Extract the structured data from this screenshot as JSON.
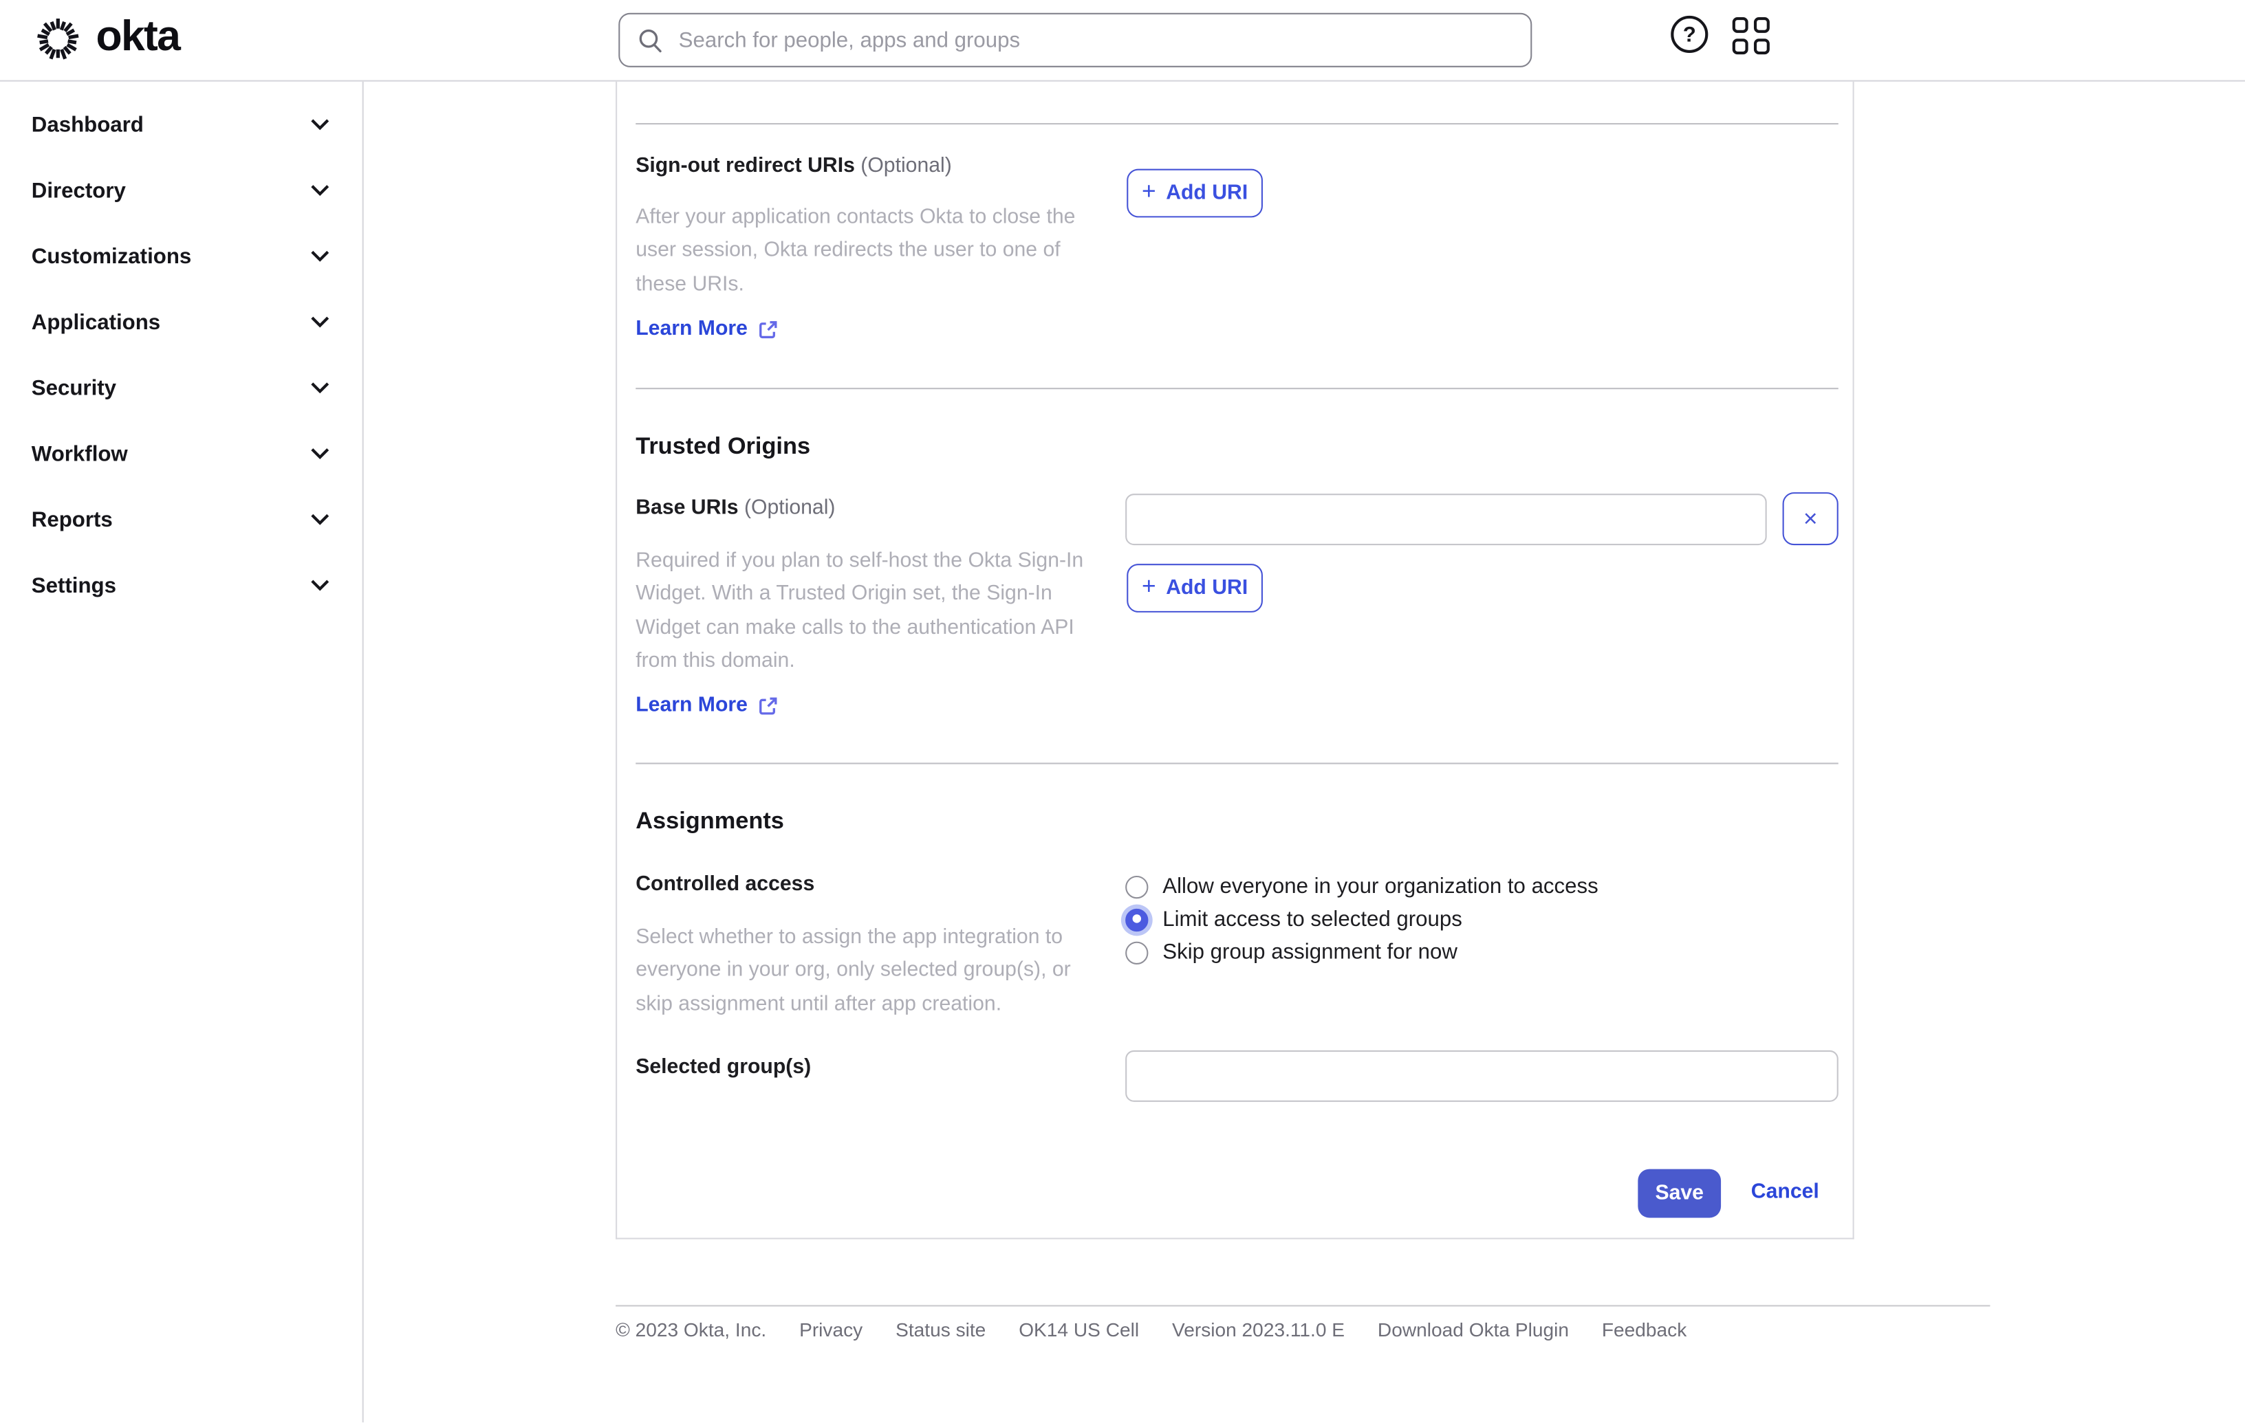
{
  "header": {
    "logo_text": "okta",
    "search_placeholder": "Search for people, apps and groups"
  },
  "icons": {
    "plus": "+",
    "close": "×",
    "help": "?"
  },
  "sidebar": {
    "items": [
      {
        "label": "Dashboard"
      },
      {
        "label": "Directory"
      },
      {
        "label": "Customizations"
      },
      {
        "label": "Applications"
      },
      {
        "label": "Security"
      },
      {
        "label": "Workflow"
      },
      {
        "label": "Reports"
      },
      {
        "label": "Settings"
      }
    ]
  },
  "main": {
    "signout": {
      "label": "Sign-out redirect URIs",
      "optional": "(Optional)",
      "description": "After your application contacts Okta to close the user session, Okta redirects the user to one of these URIs.",
      "learn_more": "Learn More",
      "add_uri_label": "Add URI"
    },
    "trusted_origins": {
      "heading": "Trusted Origins",
      "base_uris_label": "Base URIs",
      "optional": "(Optional)",
      "input_value": "",
      "description": "Required if you plan to self-host the Okta Sign-In Widget. With a Trusted Origin set, the Sign-In Widget can make calls to the authentication API from this domain.",
      "learn_more": "Learn More",
      "add_uri_label": "Add URI"
    },
    "assignments": {
      "heading": "Assignments",
      "controlled_access_label": "Controlled access",
      "description": "Select whether to assign the app integration to everyone in your org, only selected group(s), or skip assignment until after app creation.",
      "options": [
        {
          "label": "Allow everyone in your organization to access",
          "selected": false
        },
        {
          "label": "Limit access to selected groups",
          "selected": true
        },
        {
          "label": "Skip group assignment for now",
          "selected": false
        }
      ],
      "selected_groups_label": "Selected group(s)",
      "selected_groups_value": ""
    },
    "actions": {
      "save": "Save",
      "cancel": "Cancel"
    }
  },
  "footer": {
    "items": [
      "© 2023 Okta, Inc.",
      "Privacy",
      "Status site",
      "OK14 US Cell",
      "Version 2023.11.0 E",
      "Download Okta Plugin",
      "Feedback"
    ]
  },
  "colors": {
    "primary": "#4a5acd",
    "link": "#2b46d9",
    "accent_border": "#4553d6"
  }
}
